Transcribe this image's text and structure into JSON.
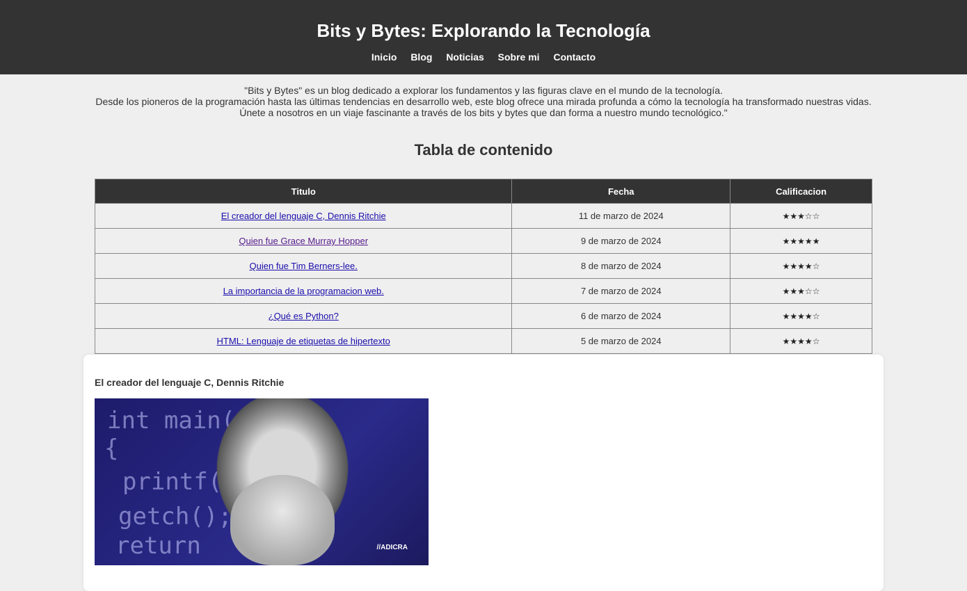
{
  "header": {
    "title": "Bits y Bytes: Explorando la Tecnología",
    "nav": [
      "Inicio",
      "Blog",
      "Noticias",
      "Sobre mi",
      "Contacto"
    ]
  },
  "intro": [
    "\"Bits y Bytes\" es un blog dedicado a explorar los fundamentos y las figuras clave en el mundo de la tecnología.",
    "Desde los pioneros de la programación hasta las últimas tendencias en desarrollo web, este blog ofrece una mirada profunda a cómo la tecnología ha transformado nuestras vidas.",
    "Únete a nosotros en un viaje fascinante a través de los bits y bytes que dan forma a nuestro mundo tecnológico.\""
  ],
  "toc": {
    "title": "Tabla de contenido",
    "headers": [
      "Titulo",
      "Fecha",
      "Calificacion"
    ],
    "rows": [
      {
        "title": "El creador del lenguaje C, Dennis Ritchie",
        "date": "11 de marzo de 2024",
        "rating": "★★★☆☆"
      },
      {
        "title": "Quien fue Grace Murray Hopper",
        "date": "9 de marzo de 2024",
        "rating": "★★★★★"
      },
      {
        "title": "Quien fue Tim Berners-lee.",
        "date": "8 de marzo de 2024",
        "rating": "★★★★☆"
      },
      {
        "title": "La importancia de la programacion web.",
        "date": "7 de marzo de 2024",
        "rating": "★★★☆☆"
      },
      {
        "title": "¿Qué es Python?",
        "date": "6 de marzo de 2024",
        "rating": "★★★★☆"
      },
      {
        "title": "HTML: Lenguaje de etiquetas de hipertexto",
        "date": "5 de marzo de 2024",
        "rating": "★★★★☆"
      }
    ]
  },
  "article": {
    "title": "El creador del lenguaje C, Dennis Ritchie",
    "image_logo": "//ADICRA"
  }
}
